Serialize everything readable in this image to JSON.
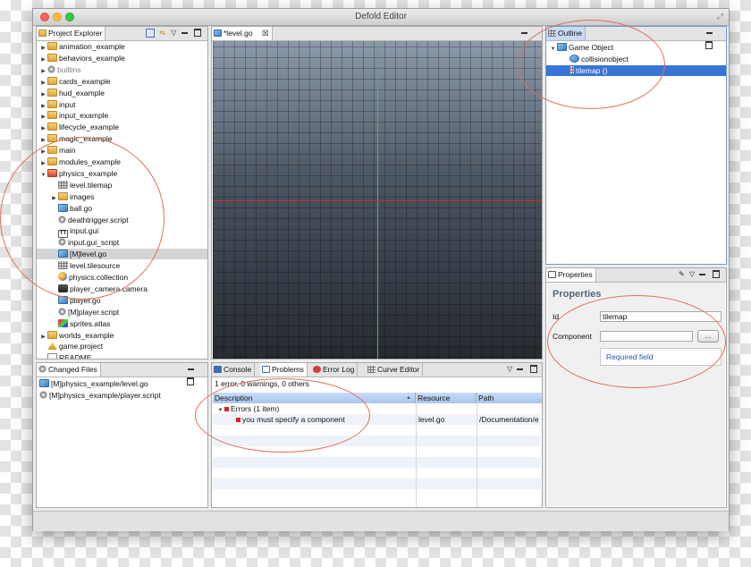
{
  "window": {
    "title": "Defold Editor"
  },
  "project_explorer": {
    "tab": "Project Explorer",
    "items": [
      {
        "label": "animation_example",
        "icon": "folder-icon",
        "arrow": "▶"
      },
      {
        "label": "behaviors_example",
        "icon": "folder-icon",
        "arrow": "▶"
      },
      {
        "label": "builtins",
        "icon": "gear-icon",
        "arrow": "▶"
      },
      {
        "label": "cards_example",
        "icon": "folder-icon",
        "arrow": "▶"
      },
      {
        "label": "hud_example",
        "icon": "folder-icon",
        "arrow": "▶"
      },
      {
        "label": "input",
        "icon": "folder-icon",
        "arrow": "▶"
      },
      {
        "label": "input_example",
        "icon": "folder-icon",
        "arrow": "▶"
      },
      {
        "label": "lifecycle_example",
        "icon": "folder-icon",
        "arrow": "▶"
      },
      {
        "label": "magic_example",
        "icon": "folder-icon",
        "arrow": "▶"
      },
      {
        "label": "main",
        "icon": "folder-icon",
        "arrow": "▶"
      },
      {
        "label": "modules_example",
        "icon": "folder-icon",
        "arrow": "▶"
      },
      {
        "label": "physics_example",
        "icon": "folder-icon",
        "arrow": "▼"
      },
      {
        "label": "level.tilemap",
        "icon": "tilemap-icon",
        "arrow": ""
      },
      {
        "label": "images",
        "icon": "folder-icon",
        "arrow": "▶"
      },
      {
        "label": "ball.go",
        "icon": "gameobject-icon",
        "arrow": ""
      },
      {
        "label": "deathtrigger.script",
        "icon": "script-icon",
        "arrow": ""
      },
      {
        "label": "input.gui",
        "icon": "gui-icon",
        "arrow": ""
      },
      {
        "label": "input.gui_script",
        "icon": "script-icon",
        "arrow": ""
      },
      {
        "label": "[M]level.go",
        "icon": "gameobject-icon",
        "arrow": ""
      },
      {
        "label": "level.tilesource",
        "icon": "tilesource-icon",
        "arrow": ""
      },
      {
        "label": "physics.collection",
        "icon": "collection-icon",
        "arrow": ""
      },
      {
        "label": "player_camera.camera",
        "icon": "camera-icon",
        "arrow": ""
      },
      {
        "label": "player.go",
        "icon": "gameobject-icon",
        "arrow": ""
      },
      {
        "label": "[M]player.script",
        "icon": "script-icon",
        "arrow": ""
      },
      {
        "label": "sprites.atlas",
        "icon": "atlas-icon",
        "arrow": ""
      },
      {
        "label": "worlds_example",
        "icon": "folder-icon",
        "arrow": "▶"
      },
      {
        "label": "game.project",
        "icon": "project-icon",
        "arrow": ""
      },
      {
        "label": "README",
        "icon": "document-icon",
        "arrow": ""
      }
    ]
  },
  "changed_files": {
    "tab": "Changed Files",
    "items": [
      "[M]physics_example/level.go",
      "[M]physics_example/player.script"
    ]
  },
  "editor": {
    "tab": "*level.go"
  },
  "bottom_tabs": [
    "Console",
    "Problems",
    "Error Log",
    "Curve Editor"
  ],
  "problems": {
    "summary": "1 error, 0 warnings, 0 others",
    "columns": [
      "Description",
      "Resource",
      "Path"
    ],
    "group": "Errors (1 item)",
    "rows": [
      {
        "description": "you must specify a component",
        "resource": "level.go",
        "path": "/Documentation/e"
      }
    ]
  },
  "outline": {
    "tab": "Outline",
    "root": "Game Object",
    "children": [
      "collisionobject",
      "tilemap ()"
    ]
  },
  "properties": {
    "tab": "Properties",
    "heading": "Properties",
    "id_label": "Id",
    "id_value": "tilemap",
    "component_label": "Component",
    "browse_label": "...",
    "required": "Required field"
  },
  "colors": {
    "accent": "#3875d7",
    "selection_gray": "#d4d4d4",
    "annotation": "#e0705a"
  }
}
